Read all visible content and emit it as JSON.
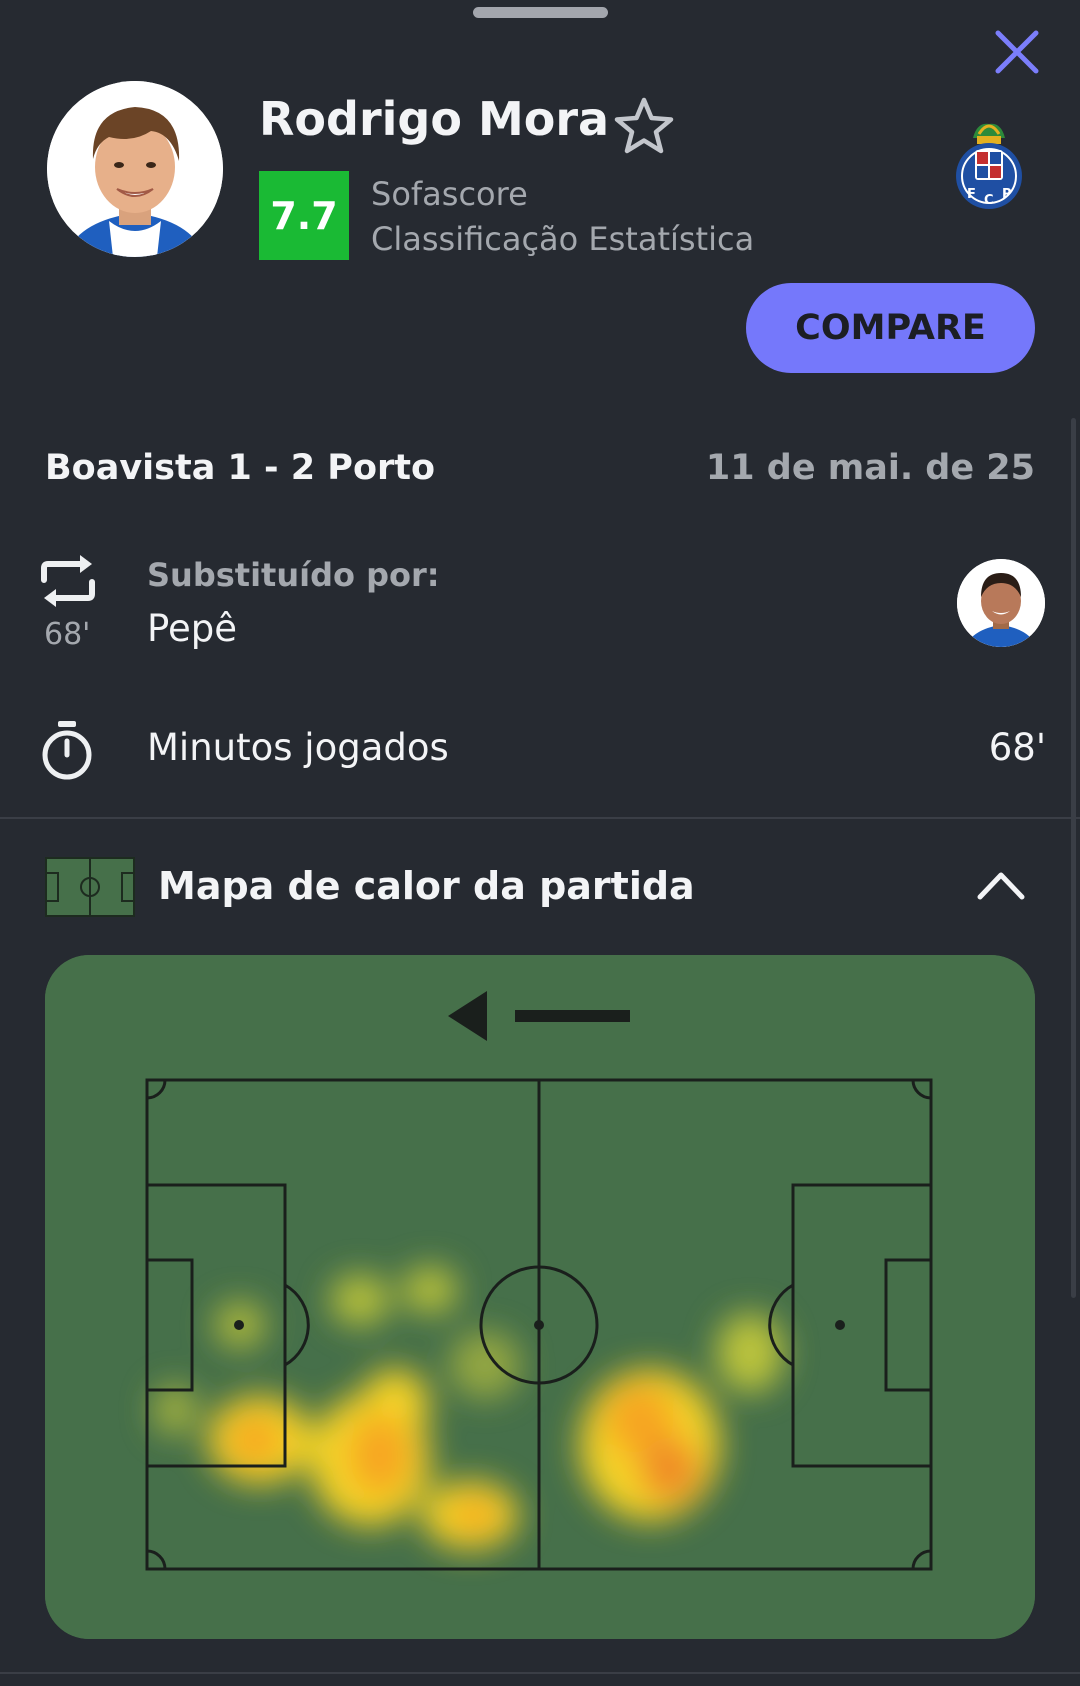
{
  "header": {
    "close_icon": "close-icon",
    "close_color": "#7b7efb"
  },
  "player": {
    "name": "Rodrigo Mora",
    "rating": "7.7",
    "rating_color": "#1aba34",
    "rating_label_line1": "Sofascore",
    "rating_label_line2": "Classificação Estatística",
    "favorite_icon": "star-outline-icon",
    "team_logo_letters": "F C P"
  },
  "actions": {
    "compare_label": "COMPARE",
    "compare_color": "#7578fb"
  },
  "match": {
    "title": "Boavista 1 - 2 Porto",
    "date": "11 de mai. de 25"
  },
  "substitution": {
    "icon": "substitution-icon",
    "minute": "68'",
    "label": "Substituído por:",
    "player_name": "Pepê"
  },
  "minutes": {
    "icon": "stopwatch-icon",
    "label": "Minutos jogados",
    "value": "68'"
  },
  "heatmap": {
    "icon": "pitch-icon",
    "title": "Mapa de calor da partida",
    "toggle_icon": "chevron-up-icon",
    "direction_icon": "arrow-left-icon",
    "pitch_color": "#46704a",
    "colors": [
      "#c8cc3a",
      "#f5d325",
      "#f7a524",
      "#f08b27"
    ]
  }
}
